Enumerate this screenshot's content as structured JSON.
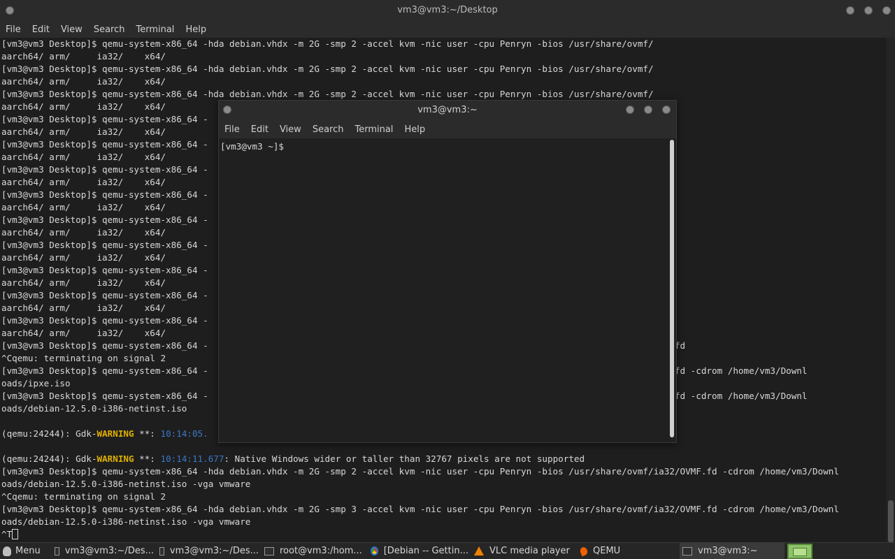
{
  "main_window": {
    "title": "vm3@vm3:~/Desktop",
    "menu": [
      "File",
      "Edit",
      "View",
      "Search",
      "Terminal",
      "Help"
    ],
    "lines": [
      "[vm3@vm3 Desktop]$ qemu-system-x86_64 -hda debian.vhdx -m 2G -smp 2 -accel kvm -nic user -cpu Penryn -bios /usr/share/ovmf/",
      "aarch64/ arm/     ia32/    x64/",
      "[vm3@vm3 Desktop]$ qemu-system-x86_64 -hda debian.vhdx -m 2G -smp 2 -accel kvm -nic user -cpu Penryn -bios /usr/share/ovmf/",
      "aarch64/ arm/     ia32/    x64/",
      "[vm3@vm3 Desktop]$ qemu-system-x86_64 -hda debian.vhdx -m 2G -smp 2 -accel kvm -nic user -cpu Penryn -bios /usr/share/ovmf/",
      "aarch64/ arm/     ia32/    x64/",
      "[vm3@vm3 Desktop]$ qemu-system-x86_64 -                                                                            f/",
      "aarch64/ arm/     ia32/    x64/",
      "[vm3@vm3 Desktop]$ qemu-system-x86_64 -                                                                            f/",
      "aarch64/ arm/     ia32/    x64/",
      "[vm3@vm3 Desktop]$ qemu-system-x86_64 -                                                                            f/",
      "aarch64/ arm/     ia32/    x64/",
      "[vm3@vm3 Desktop]$ qemu-system-x86_64 -                                                                            f/",
      "aarch64/ arm/     ia32/    x64/",
      "[vm3@vm3 Desktop]$ qemu-system-x86_64 -                                                                            f/",
      "aarch64/ arm/     ia32/    x64/",
      "[vm3@vm3 Desktop]$ qemu-system-x86_64 -                                                                            f/",
      "aarch64/ arm/     ia32/    x64/",
      "[vm3@vm3 Desktop]$ qemu-system-x86_64 -                                                                            f/",
      "aarch64/ arm/     ia32/    x64/",
      "[vm3@vm3 Desktop]$ qemu-system-x86_64 -                                                                            f/",
      "aarch64/ arm/     ia32/    x64/",
      "[vm3@vm3 Desktop]$ qemu-system-x86_64 -                                                                            f/",
      "aarch64/ arm/     ia32/    x64/",
      "[vm3@vm3 Desktop]$ qemu-system-x86_64 -                                                                            f/ia32/OVMF.fd",
      "^Cqemu: terminating on signal 2",
      "[vm3@vm3 Desktop]$ qemu-system-x86_64 -                                                                            f/ia32/OVMF.fd -cdrom /home/vm3/Downl",
      "oads/ipxe.iso",
      "[vm3@vm3 Desktop]$ qemu-system-x86_64 -                                                                            f/ia32/OVMF.fd -cdrom /home/vm3/Downl",
      "oads/debian-12.5.0-i386-netinst.iso",
      ""
    ],
    "warn1": {
      "prefix": "(qemu:24244): Gdk-",
      "level": "WARNING",
      "mid": " **: ",
      "time": "10:14:05.",
      "rest": ""
    },
    "blank2": "",
    "warn2": {
      "prefix": "(qemu:24244): Gdk-",
      "level": "WARNING",
      "mid": " **: ",
      "time": "10:14:11.677",
      "rest": ": Native Windows wider or taller than 32767 pixels are not supported"
    },
    "tail": [
      "[vm3@vm3 Desktop]$ qemu-system-x86_64 -hda debian.vhdx -m 2G -smp 2 -accel kvm -nic user -cpu Penryn -bios /usr/share/ovmf/ia32/OVMF.fd -cdrom /home/vm3/Downl",
      "oads/debian-12.5.0-i386-netinst.iso -vga vmware",
      "^Cqemu: terminating on signal 2",
      "[vm3@vm3 Desktop]$ qemu-system-x86_64 -hda debian.vhdx -m 2G -smp 3 -accel kvm -nic user -cpu Penryn -bios /usr/share/ovmf/ia32/OVMF.fd -cdrom /home/vm3/Downl",
      "oads/debian-12.5.0-i386-netinst.iso -vga vmware"
    ],
    "last_prompt": "^T"
  },
  "small_window": {
    "title": "vm3@vm3:~",
    "menu": [
      "File",
      "Edit",
      "View",
      "Search",
      "Terminal",
      "Help"
    ],
    "prompt": "[vm3@vm3 ~]$"
  },
  "taskbar": {
    "menu_label": "Menu",
    "items": [
      {
        "label": "vm3@vm3:~/Des...",
        "icon": "terminal-icon"
      },
      {
        "label": "vm3@vm3:~/Des...",
        "icon": "terminal-icon"
      },
      {
        "label": "root@vm3:/hom...",
        "icon": "terminal-icon"
      },
      {
        "label": "[Debian -- Gettin...",
        "icon": "chrome-icon"
      },
      {
        "label": "VLC media player",
        "icon": "vlc-icon"
      },
      {
        "label": "QEMU",
        "icon": "qemu-icon"
      },
      {
        "label": "vm3@vm3:~",
        "icon": "terminal-icon"
      }
    ]
  }
}
